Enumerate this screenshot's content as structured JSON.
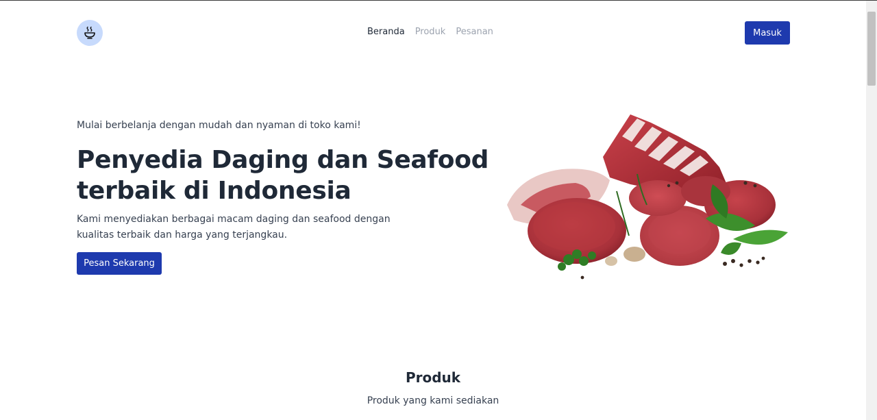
{
  "nav": {
    "logo_icon": "bowl-icon",
    "links": [
      "Beranda",
      "Produk",
      "Pesanan"
    ],
    "login_label": "Masuk"
  },
  "hero": {
    "tagline": "Mulai berbelanja dengan mudah dan nyaman di toko kami!",
    "headline_line1": "Penyedia Daging dan Seafood",
    "headline_line2": "terbaik di Indonesia",
    "desc_line1": "Kami menyediakan berbagai macam daging dan seafood dengan",
    "desc_line2": "kualitas terbaik dan harga yang terjangkau.",
    "cta_label": "Pesan Sekarang",
    "image_subject": "raw-meat-cuts-with-herbs"
  },
  "products": {
    "title": "Produk",
    "subtitle": "Produk yang kami sediakan"
  },
  "colors": {
    "primary": "#1e3aae",
    "logo_bg": "#c7dafc",
    "text": "#1f2937",
    "muted": "#9ca3af"
  }
}
